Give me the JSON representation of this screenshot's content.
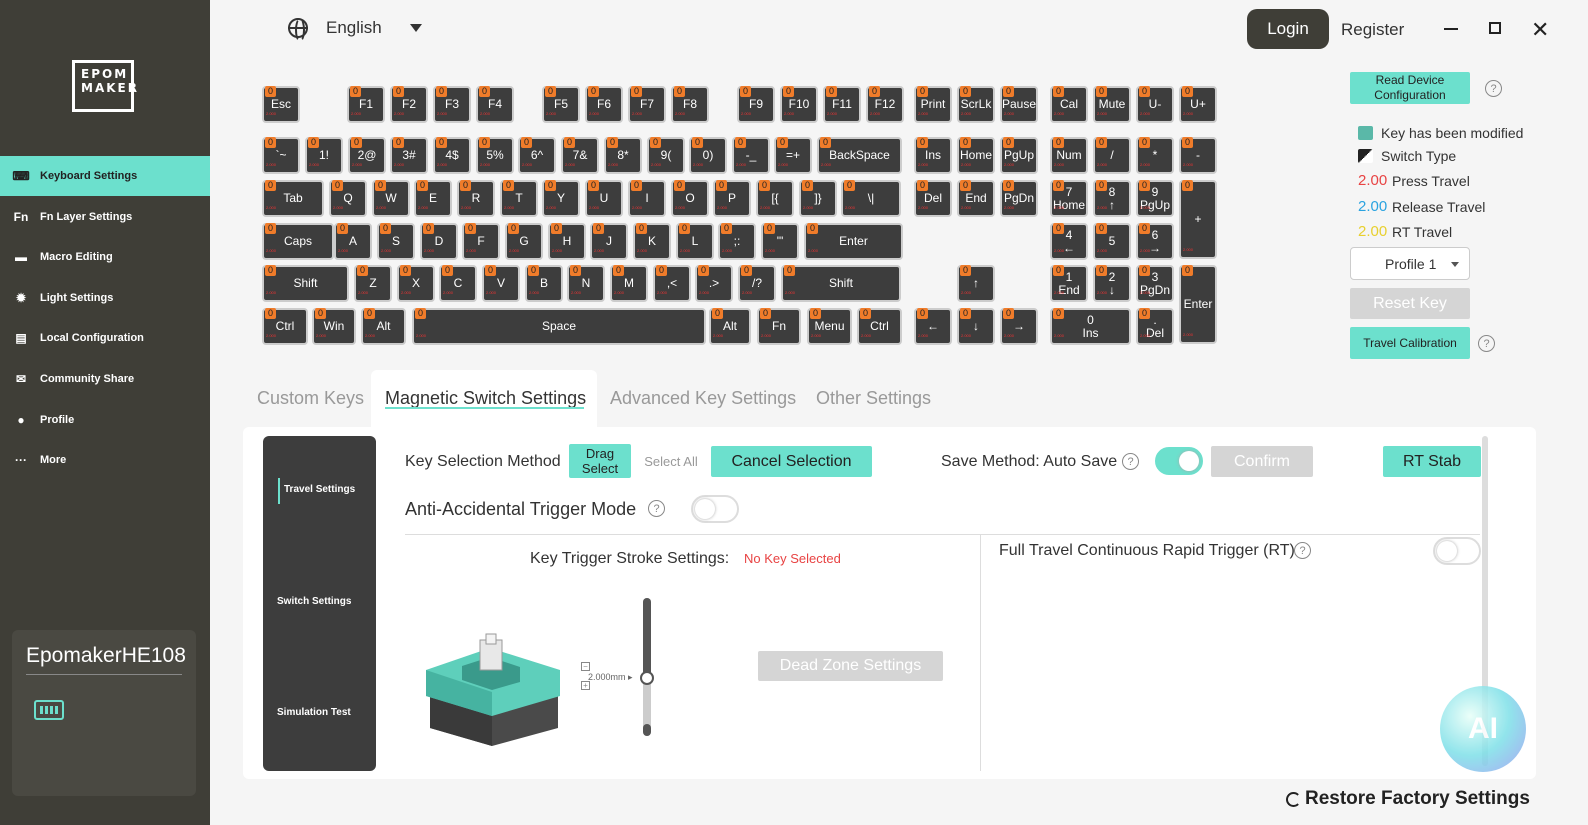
{
  "brand": {
    "logo_text": "EPOM\nMAKER"
  },
  "sidebar": {
    "items": [
      {
        "label": "Keyboard Settings",
        "icon": "keyboard-icon"
      },
      {
        "label": "Fn Layer Settings",
        "icon": "fn-icon"
      },
      {
        "label": "Macro Editing",
        "icon": "macro-icon"
      },
      {
        "label": "Light Settings",
        "icon": "light-icon"
      },
      {
        "label": "Local Configuration",
        "icon": "config-icon"
      },
      {
        "label": "Community Share",
        "icon": "chat-icon"
      },
      {
        "label": "Profile",
        "icon": "user-icon"
      },
      {
        "label": "More",
        "icon": "more-icon"
      }
    ],
    "device_name": "EpomakerHE108"
  },
  "topbar": {
    "language": "English",
    "login": "Login",
    "register": "Register"
  },
  "keyboard": {
    "rows": [
      [
        "Esc",
        "F1",
        "F2",
        "F3",
        "F4",
        "F5",
        "F6",
        "F7",
        "F8",
        "F9",
        "F10",
        "F11",
        "F12",
        "Print",
        "ScrLk",
        "Pause",
        "Cal",
        "Mute",
        "U-",
        "U+"
      ],
      [
        "`~",
        "1!",
        "2@",
        "3#",
        "4$",
        "5%",
        "6^",
        "7&",
        "8*",
        "9(",
        "0)",
        "-_",
        "=+",
        "BackSpace",
        "Ins",
        "Home",
        "PgUp",
        "Num",
        "/",
        "*",
        "-"
      ],
      [
        "Tab",
        "Q",
        "W",
        "E",
        "R",
        "T",
        "Y",
        "U",
        "I",
        "O",
        "P",
        "[{",
        "]}",
        "\\|",
        "Del",
        "End",
        "PgDn",
        "7\nHome",
        "8\n↑",
        "9\nPgUp",
        "+"
      ],
      [
        "Caps",
        "A",
        "S",
        "D",
        "F",
        "G",
        "H",
        "J",
        "K",
        "L",
        ";:",
        "'\"",
        "Enter",
        "4\n←",
        "5",
        "6\n→"
      ],
      [
        "Shift",
        "Z",
        "X",
        "C",
        "V",
        "B",
        "N",
        "M",
        ",<",
        ".>",
        "/?",
        "Shift",
        "↑",
        "1\nEnd",
        "2\n↓",
        "3\nPgDn",
        "Enter"
      ],
      [
        "Ctrl",
        "Win",
        "Alt",
        "Space",
        "Alt",
        "Fn",
        "Menu",
        "Ctrl",
        "←",
        "↓",
        "→",
        "0\nIns",
        ".\nDel"
      ]
    ],
    "badge": "0",
    "press_travel_text": "2.000"
  },
  "right_panel": {
    "read_device": "Read Device Configuration",
    "legend": [
      {
        "num": "",
        "label": "Key has been modified",
        "color": "#5ab8a8"
      },
      {
        "num": "",
        "label": "Switch Type",
        "color": "#222222"
      },
      {
        "num": "2.00",
        "label": "Press Travel",
        "color": "#e84343"
      },
      {
        "num": "2.00",
        "label": "Release Travel",
        "color": "#2aa3e0"
      },
      {
        "num": "2.00",
        "label": "RT Travel",
        "color": "#e8d02e"
      }
    ],
    "profile": "Profile 1",
    "reset_key": "Reset Key",
    "travel_calibration": "Travel Calibration"
  },
  "tabs": [
    "Custom Keys",
    "Magnetic Switch Settings",
    "Advanced Key Settings",
    "Other Settings"
  ],
  "subnav": [
    "Travel Settings",
    "Switch Settings",
    "Simulation Test"
  ],
  "settings": {
    "key_selection_method": "Key Selection Method",
    "drag_select": "Drag Select",
    "select_all": "Select All",
    "cancel_selection": "Cancel Selection",
    "save_method": "Save Method: Auto Save",
    "save_toggle_on": true,
    "confirm": "Confirm",
    "rt_stab": "RT Stab",
    "anti_accidental": "Anti-Accidental Trigger Mode",
    "anti_toggle_on": false,
    "key_trigger_stroke": "Key Trigger Stroke Settings:",
    "no_key_selected": "No Key Selected",
    "slider_value": "2.000mm",
    "dead_zone": "Dead Zone Settings",
    "full_travel_rt": "Full Travel Continuous Rapid Trigger (RT)",
    "rt_toggle_on": false
  },
  "restore_factory": "Restore Factory Settings",
  "ai_bubble": "AI"
}
